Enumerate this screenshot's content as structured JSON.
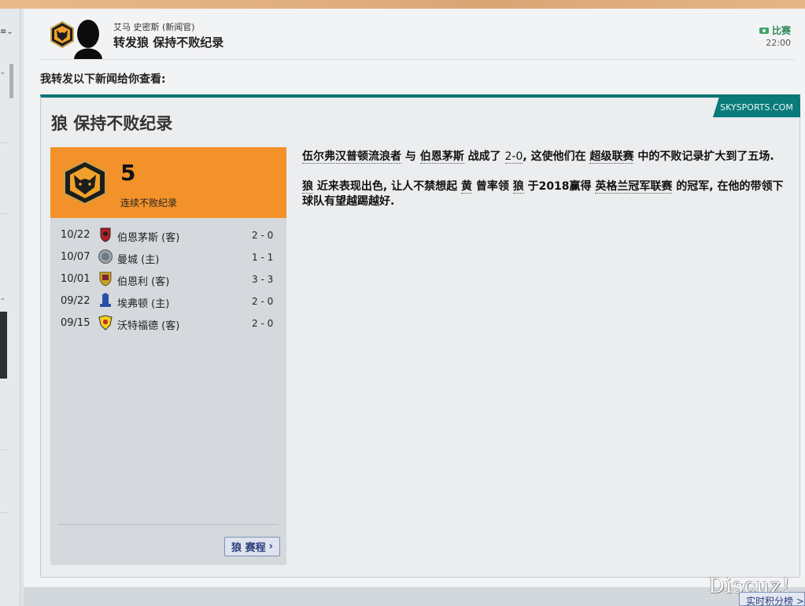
{
  "message": {
    "sender": "艾马 史密斯 (新闻官)",
    "subject": "转发狼 保持不败纪录",
    "tag": "比赛",
    "time": "22:00",
    "intro": "我转发以下新闻给你查看:"
  },
  "news": {
    "source": "SKYSPORTS.COM",
    "title": "狼 保持不败纪录",
    "streak_value": "5",
    "streak_label": "连续不败纪录",
    "results": [
      {
        "date": "10/22",
        "team": "伯恩茅斯 (客)",
        "score": "2 - 0",
        "crest": "bournemouth-crest-icon"
      },
      {
        "date": "10/07",
        "team": "曼城 (主)",
        "score": "1 - 1",
        "crest": "man-city-crest-icon"
      },
      {
        "date": "10/01",
        "team": "伯恩利 (客)",
        "score": "3 - 3",
        "crest": "burnley-crest-icon"
      },
      {
        "date": "09/22",
        "team": "埃弗顿 (主)",
        "score": "2 - 0",
        "crest": "everton-crest-icon"
      },
      {
        "date": "09/15",
        "team": "沃特福德 (客)",
        "score": "2 - 0",
        "crest": "watford-crest-icon"
      }
    ],
    "fixtures_button": "狼 赛程",
    "para1": {
      "team1": "伍尔弗汉普顿流浪者",
      "with": " 与 ",
      "team2": "伯恩茅斯",
      "drew": " 战成了 ",
      "score": "2-0",
      "mid": ", 这使他们在 ",
      "league": "超级联赛",
      "end": " 中的不败记录扩大到了五场."
    },
    "para2": {
      "a": "狼",
      "b": " 近来表现出色, 让人不禁想起 ",
      "c": "黄",
      "d": " 曾率领 ",
      "e": "狼",
      "f": " 于2018赢得 ",
      "g": "英格兰冠军联赛",
      "h": " 的冠军, 在他的带领下球队有望越踢越好."
    }
  },
  "watermark": "Discuz!",
  "live_link": "实时积分榜 >",
  "colors": {
    "accent_teal": "#087474",
    "streak_orange": "#f3922a",
    "tag_green": "#2e8b57"
  }
}
